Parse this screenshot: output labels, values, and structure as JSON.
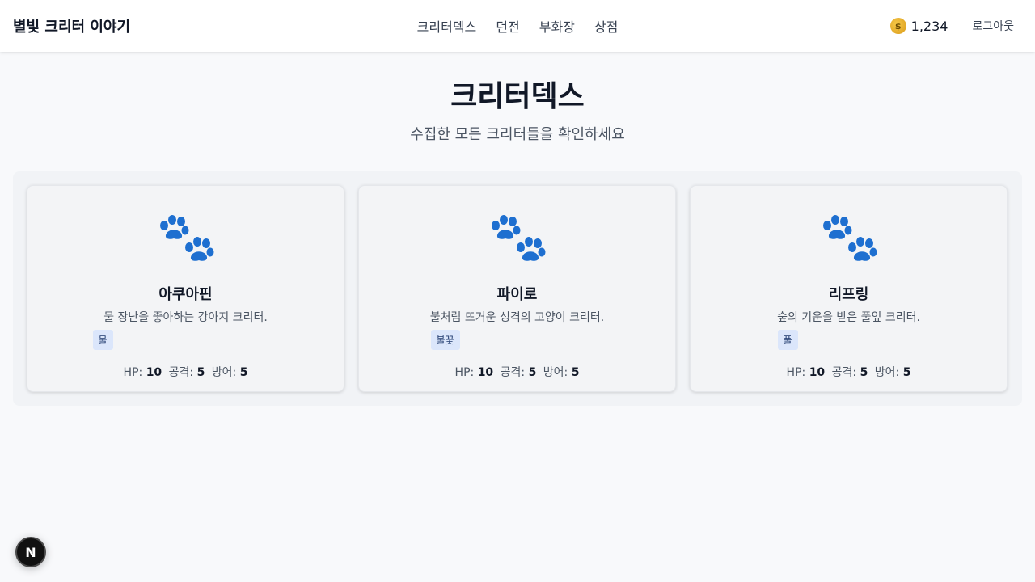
{
  "header": {
    "brand": "별빛 크리터 이야기",
    "nav": [
      "크리터덱스",
      "던전",
      "부화장",
      "상점"
    ],
    "coins": "1,234",
    "coin_icon": "money-bag-icon",
    "logout_label": "로그아웃"
  },
  "page": {
    "title": "크리터덱스",
    "subtitle": "수집한 모든 크리터들을 확인하세요"
  },
  "critters": [
    {
      "name": "아쿠아핀",
      "description": "물 장난을 좋아하는 강아지 크리터.",
      "tag": "물",
      "hp_label": "HP:",
      "hp": "10",
      "atk_label": "공격:",
      "atk": "5",
      "def_label": "방어:",
      "def": "5",
      "icon": "paw-icon"
    },
    {
      "name": "파이로",
      "description": "불처럼 뜨거운 성격의 고양이 크리터.",
      "tag": "불꽃",
      "hp_label": "HP:",
      "hp": "10",
      "atk_label": "공격:",
      "atk": "5",
      "def_label": "방어:",
      "def": "5",
      "icon": "paw-icon"
    },
    {
      "name": "리프링",
      "description": "숲의 기운을 받은 풀잎 크리터.",
      "tag": "풀",
      "hp_label": "HP:",
      "hp": "10",
      "atk_label": "공격:",
      "atk": "5",
      "def_label": "방어:",
      "def": "5",
      "icon": "paw-icon"
    }
  ],
  "dev_badge": "N",
  "colors": {
    "paw": "#1e6fd0",
    "tag_bg": "#dbe6fb"
  }
}
